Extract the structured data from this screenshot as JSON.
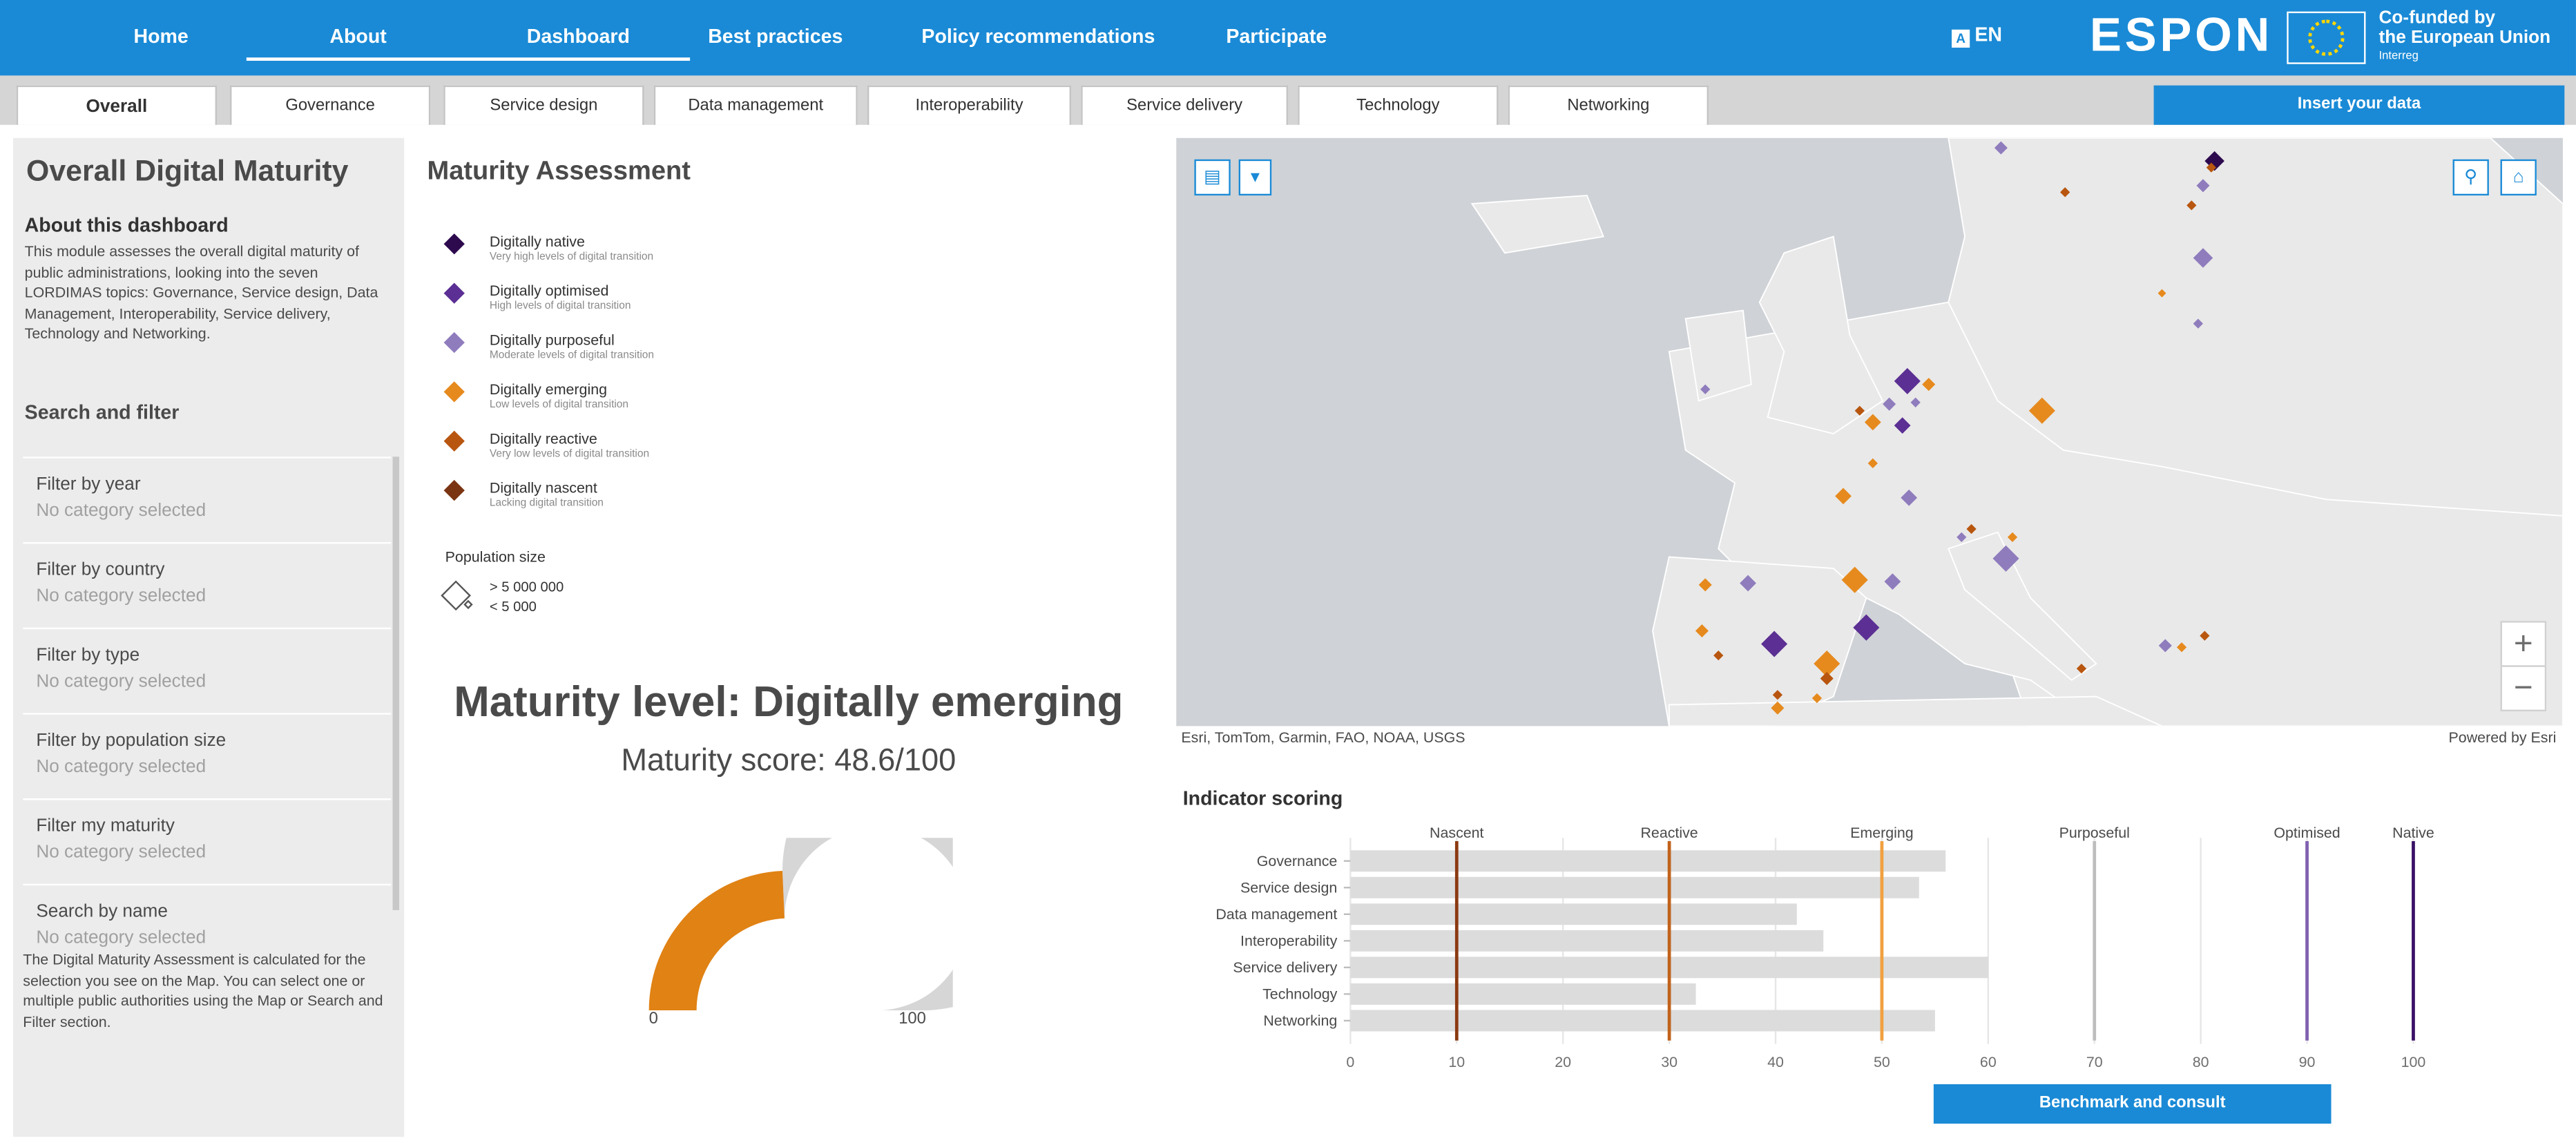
{
  "nav": {
    "items": [
      "Home",
      "About",
      "Dashboard",
      "Best practices",
      "Policy recommendations",
      "Participate"
    ],
    "language": "EN",
    "brand": "ESPON",
    "eu_line1": "Co-funded by",
    "eu_line2": "the European Union",
    "eu_line3": "Interreg"
  },
  "tabs": [
    "Overall",
    "Governance",
    "Service design",
    "Data management",
    "Interoperability",
    "Service delivery",
    "Technology",
    "Networking"
  ],
  "insert_button": "Insert your data",
  "sidebar": {
    "title": "Overall Digital Maturity",
    "about_heading": "About this dashboard",
    "about_text": "This module assesses the overall digital maturity of public administrations, looking into the seven LORDIMAS topics: Governance, Service design, Data Management, Interoperability, Service delivery, Technology and Networking.",
    "search_heading": "Search and filter",
    "filters": [
      {
        "label": "Filter by year",
        "value": "No category selected"
      },
      {
        "label": "Filter by country",
        "value": "No category selected"
      },
      {
        "label": "Filter by type",
        "value": "No category selected"
      },
      {
        "label": "Filter by population size",
        "value": "No category selected"
      },
      {
        "label": "Filter my maturity",
        "value": "No category selected"
      },
      {
        "label": "Search by name",
        "value": "No category selected"
      }
    ],
    "footer_text": "The Digital Maturity Assessment is calculated for the selection you see on the Map. You can select one or multiple public authorities using the Map or Search and Filter section."
  },
  "assessment": {
    "title": "Maturity Assessment",
    "legend": [
      {
        "name": "Digitally native",
        "desc": "Very high levels of digital transition",
        "color": "#2d0a4e"
      },
      {
        "name": "Digitally optimised",
        "desc": "High levels of digital transition",
        "color": "#5b2f93"
      },
      {
        "name": "Digitally purposeful",
        "desc": "Moderate levels of digital transition",
        "color": "#8f7cbd"
      },
      {
        "name": "Digitally emerging",
        "desc": "Low levels of digital transition",
        "color": "#e68a1e"
      },
      {
        "name": "Digitally reactive",
        "desc": "Very low levels of digital transition",
        "color": "#b8560f"
      },
      {
        "name": "Digitally nascent",
        "desc": "Lacking digital transition",
        "color": "#7a3412"
      }
    ],
    "population_title": "Population size",
    "population_big": "> 5 000 000",
    "population_small": "< 5 000",
    "maturity_level": "Maturity level: Digitally emerging",
    "maturity_score": "Maturity score: 48.6/100",
    "gauge": {
      "value": 48.6,
      "min_label": "0",
      "max_label": "100",
      "fill_color": "#e08214",
      "track_color": "#d6d6d6"
    }
  },
  "map": {
    "credit_left": "Esri, TomTom, Garmin, FAO, NOAA, USGS",
    "credit_right": "Powered by Esri",
    "zoom_in": "+",
    "zoom_out": "−"
  },
  "indicator": {
    "title": "Indicator scoring",
    "benchmark_button": "Benchmark and consult"
  },
  "chart_data": {
    "type": "bar",
    "title": "Indicator scoring",
    "categories": [
      "Governance",
      "Service design",
      "Data management",
      "Interoperability",
      "Service delivery",
      "Technology",
      "Networking"
    ],
    "values": [
      56,
      53.5,
      42,
      44.5,
      60,
      32.5,
      55
    ],
    "xlim": [
      0,
      100
    ],
    "xticks": [
      0,
      10,
      20,
      30,
      40,
      50,
      60,
      70,
      80,
      90,
      100
    ],
    "thresholds": [
      {
        "name": "Nascent",
        "value": 10,
        "color": "#8b3a10"
      },
      {
        "name": "Reactive",
        "value": 30,
        "color": "#c1621b"
      },
      {
        "name": "Emerging",
        "value": 50,
        "color": "#f0a040"
      },
      {
        "name": "Purposeful",
        "value": 70,
        "color": "#bdbdbd"
      },
      {
        "name": "Optimised",
        "value": 90,
        "color": "#8060b0"
      },
      {
        "name": "Native",
        "value": 100,
        "color": "#3a1066"
      }
    ],
    "bar_color": "#dcdcdc",
    "grid": true
  }
}
